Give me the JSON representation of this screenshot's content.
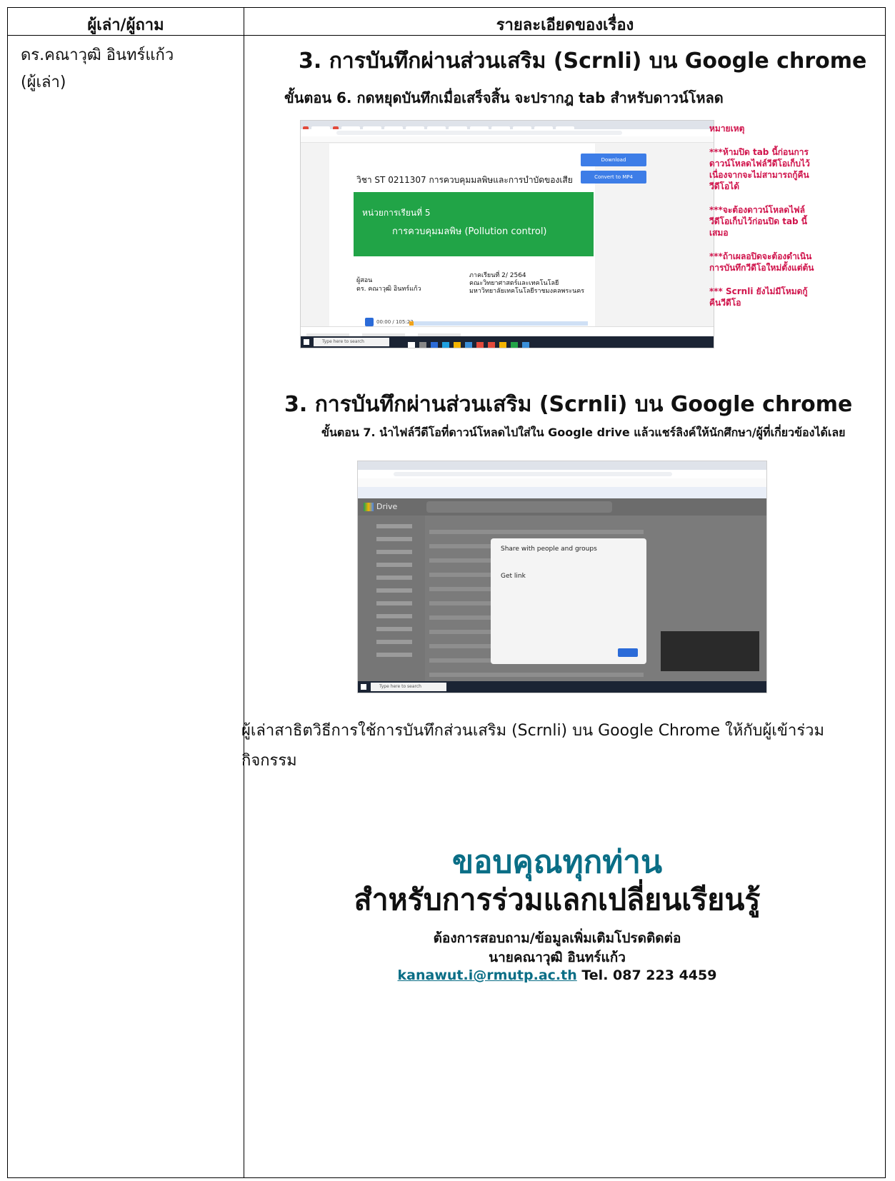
{
  "table": {
    "col1_header": "ผู้เล่า/ผู้ถาม",
    "col2_header": "รายละเอียดของเรื่อง"
  },
  "narrator": {
    "name": "ดร.คณาวุฒิ  อินทร์แก้ว",
    "role": "(ผู้เล่า)"
  },
  "slide1": {
    "title": "3.  การบันทึกผ่านส่วนเสริม (Scrnli) บน Google chrome",
    "step": "ขั้นตอน 6. กดหยุดบันทึกเมื่อเสร็จสิ้น จะปรากฎ tab สำหรับดาวน์โหลด",
    "ppt_course": "วิชา ST 0211307 การควบคุมมลพิษและการบำบัดของเสีย",
    "ppt_unit": "หน่วยการเรียนที่ 5",
    "ppt_unit_name": "การควบคุมมลพิษ (Pollution control)",
    "ppt_teacher_label": "ผู้สอน",
    "ppt_teacher": "ดร. คณาวุฒิ อินทร์แก้ว",
    "ppt_term": "ภาคเรียนที่ 2/ 2564",
    "ppt_faculty": "คณะวิทยาศาสตร์และเทคโนโลยี",
    "ppt_university": "มหาวิทยาลัยเทคโนโลยีราชมงคลพระนคร",
    "player_time": "00:00 / 105:23",
    "download_button": "Download",
    "convert_button": "Convert to MP4",
    "taskbar_search": "Type here to search",
    "notes_title": "หมายเหตุ",
    "notes": [
      "***ห้ามปิด tab นี้ก่อนการดาวน์โหลดไฟล์วีดีโอเก็บไว้เนื่องจากจะไม่สามารถกู้คืนวีดีโอได้",
      "***จะต้องดาวน์โหลดไฟล์วีดีโอเก็บไว้ก่อนปิด tab นี้เสมอ",
      "***ถ้าเผลอปิดจะต้องดำเนินการบันทึกวีดีโอใหม่ตั้งแต่ต้น",
      "*** Scrnli ยังไม่มีโหมดกู้คืนวีดีโอ"
    ]
  },
  "slide2": {
    "title": "3.  การบันทึกผ่านส่วนเสริม (Scrnli) บน Google chrome",
    "step": "ขั้นตอน 7. นำไฟล์วีดีโอที่ดาวน์โหลดไปใส่ใน Google drive แล้วแชร์ลิงค์ให้นักศึกษา/ผู้ที่เกี่ยวข้องได้เลย",
    "drive_label": "Drive",
    "dialog_share": "Share with people and groups",
    "dialog_link": "Get link",
    "taskbar_search": "Type here to search"
  },
  "description": "ผู้เล่าสาธิตวิธีการใช้การบันทึกส่วนเสริม (Scrnli) บน Google Chrome ให้กับผู้เข้าร่วมกิจกรรม",
  "thanks": {
    "line1": "ขอบคุณทุกท่าน",
    "line2": "สำหรับการร่วมแลกเปลี่ยนเรียนรู้",
    "contact_line": "ต้องการสอบถาม/ข้อมูลเพิ่มเติมโปรดติดต่อ",
    "contact_name": "นายคณาวุฒิ อินทร์แก้ว",
    "email": "kanawut.i@rmutp.ac.th",
    "phone": "Tel. 087 223 4459"
  }
}
